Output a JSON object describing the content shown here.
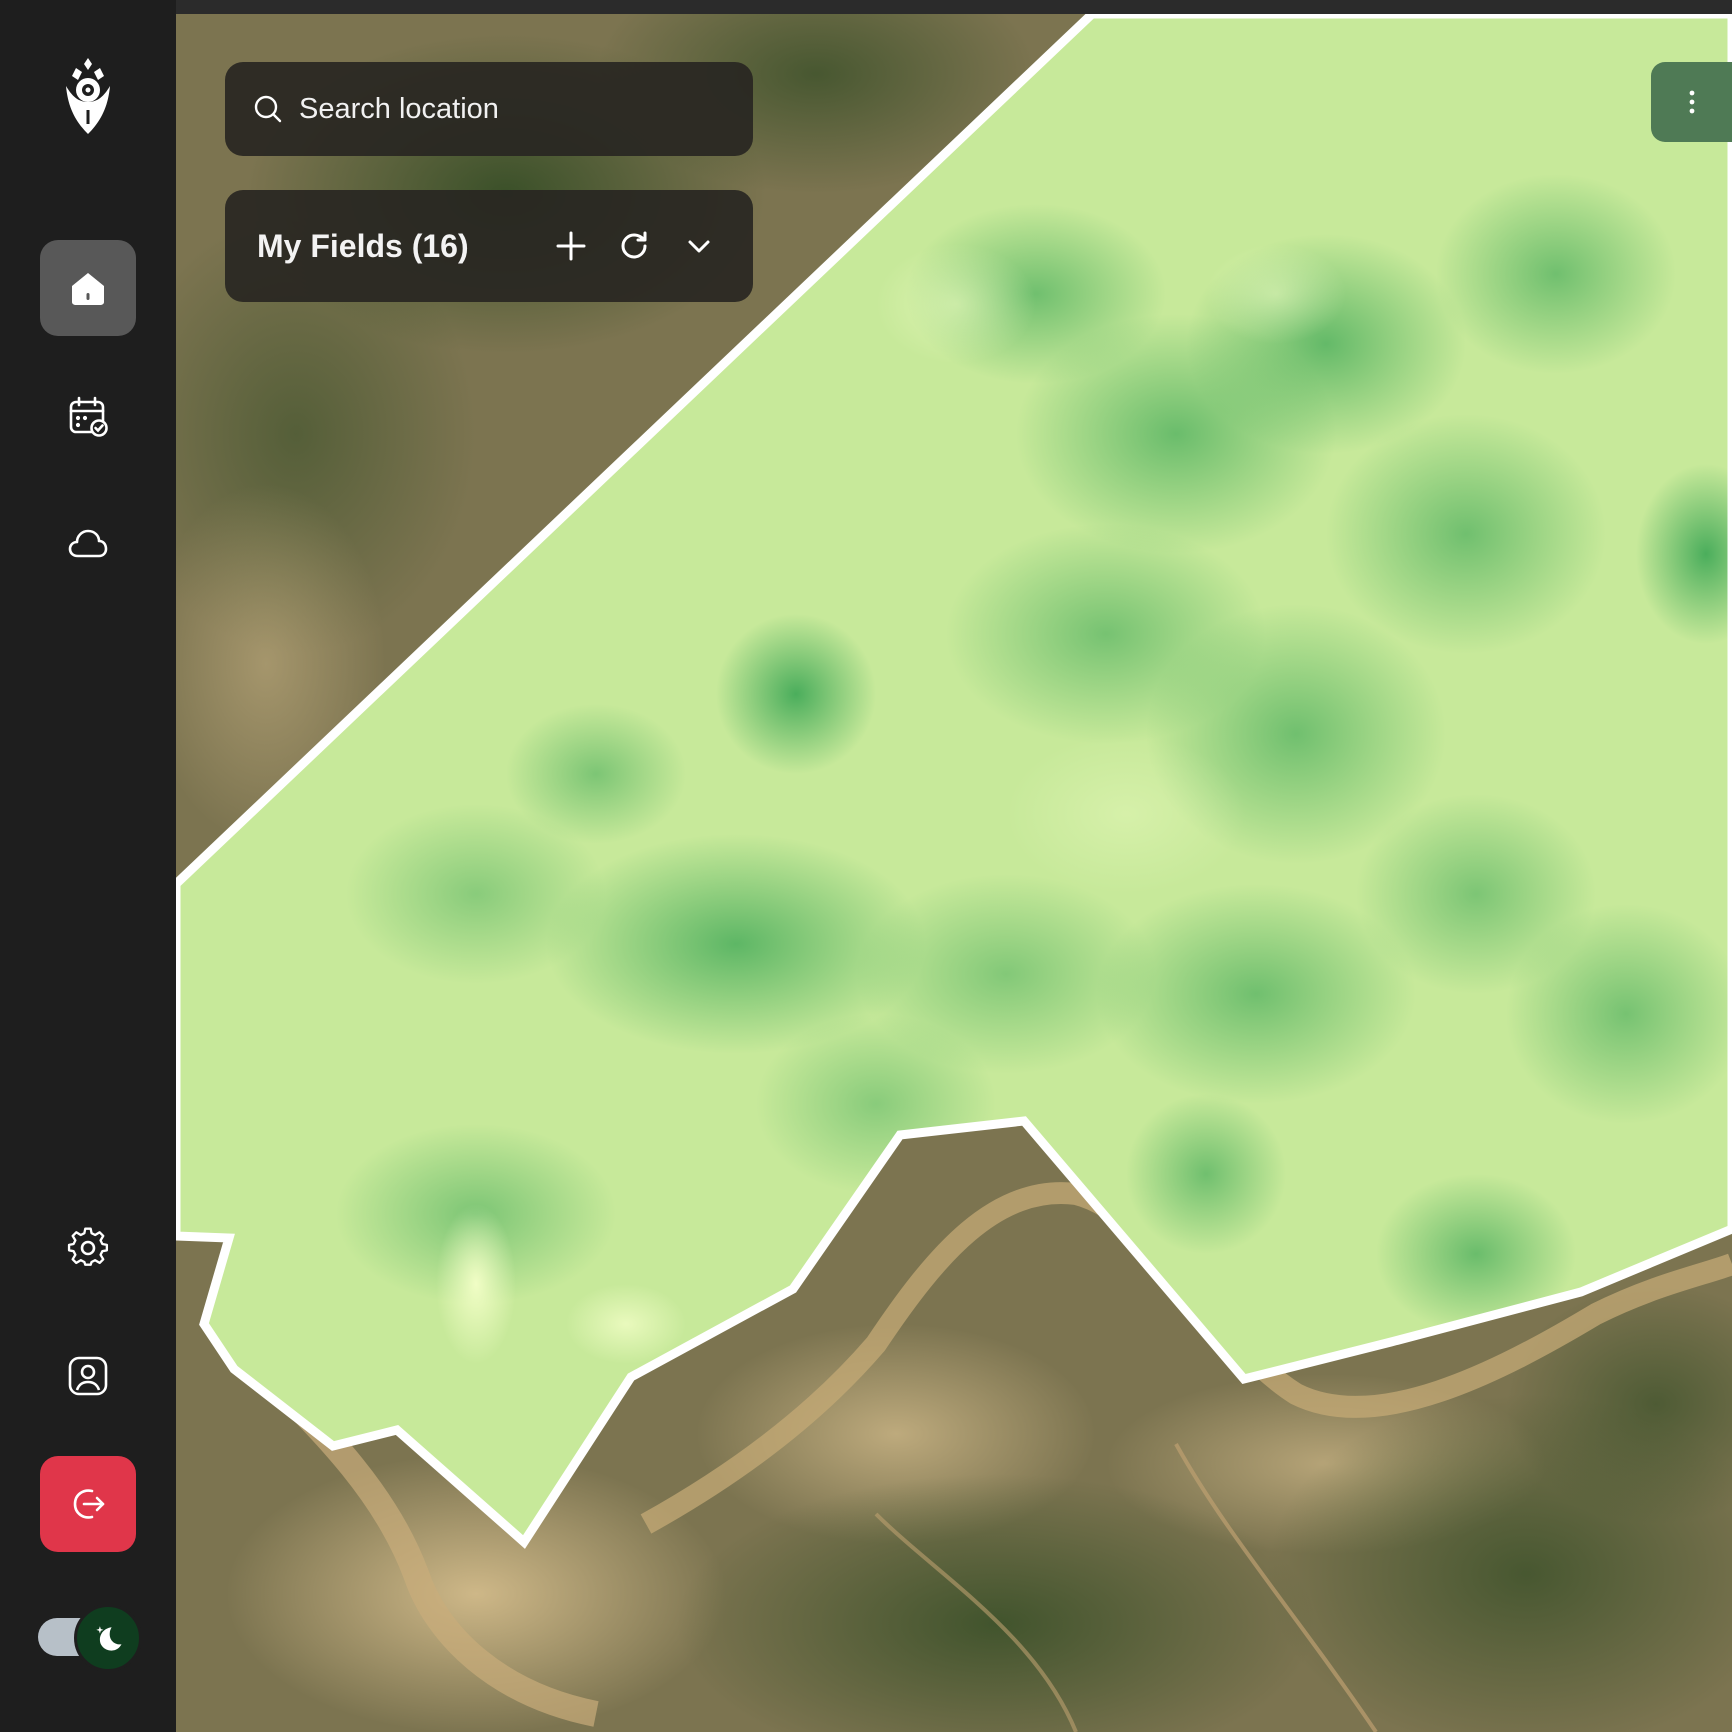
{
  "search": {
    "placeholder": "Search location"
  },
  "fields_panel": {
    "title": "My Fields (16)"
  },
  "sidebar": {
    "items": [
      {
        "icon": "home-icon",
        "active": true
      },
      {
        "icon": "calendar-check-icon"
      },
      {
        "icon": "cloud-icon"
      },
      {
        "icon": "gear-icon"
      },
      {
        "icon": "user-profile-icon"
      },
      {
        "icon": "logout-icon"
      }
    ],
    "theme_toggle": {
      "state": "dark",
      "icon": "moon-icon"
    }
  },
  "colors": {
    "sidebar_bg": "#1e1e1e",
    "active_item": "#585858",
    "logout_bg": "#e0364a",
    "field_overlay_light": "#c9eb9c",
    "field_overlay_dark": "#4cb060",
    "menu_button": "#4f7a55"
  }
}
